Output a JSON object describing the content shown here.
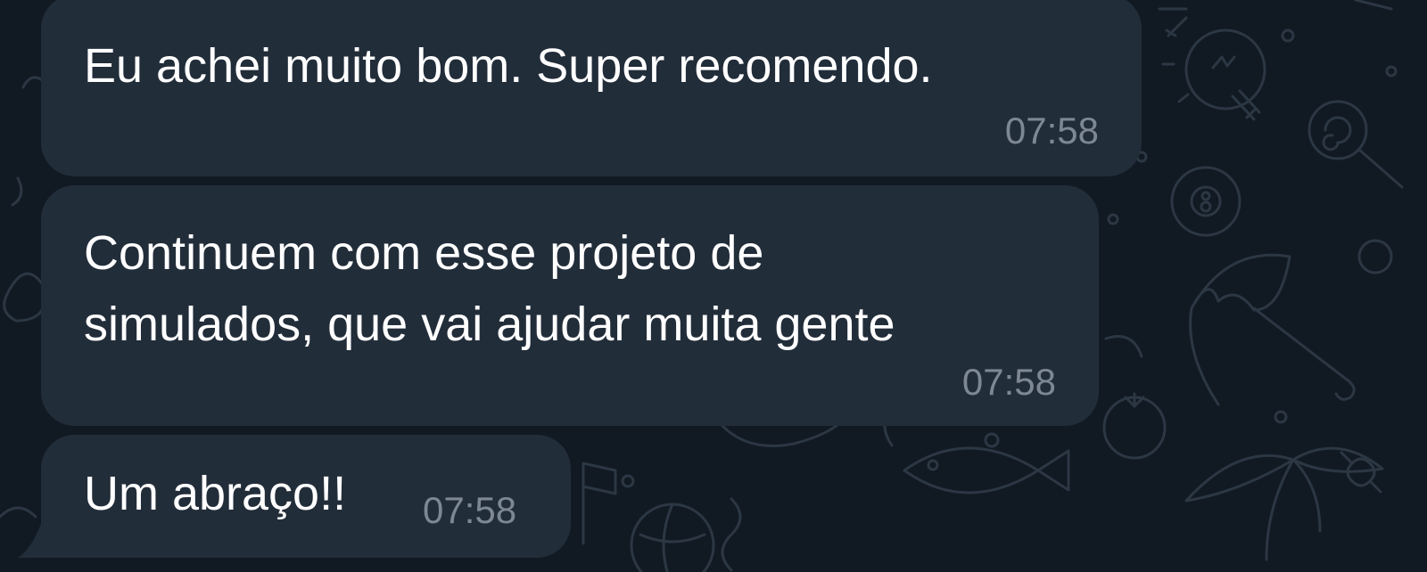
{
  "messages": [
    {
      "text": "Eu achei muito bom. Super recomendo.",
      "time": "07:58"
    },
    {
      "text_lines": [
        "Continuem com esse projeto de",
        "simulados, que vai ajudar muita gente"
      ],
      "time": "07:58"
    },
    {
      "text": "Um abraço!!",
      "time": "07:58"
    }
  ],
  "colors": {
    "background": "#111a23",
    "bubble": "#222d3a",
    "message_text": "#ffffff",
    "timestamp": "#7d8894",
    "doodle": "#2c3744"
  },
  "wallpaper_icons": [
    "lightbulb-icon",
    "lollipop-icon",
    "eight-ball-icon",
    "umbrella-icon",
    "tomato-icon",
    "fish-icon",
    "palm-tree-icon",
    "flag-icon",
    "globe-icon",
    "candy-icon"
  ]
}
